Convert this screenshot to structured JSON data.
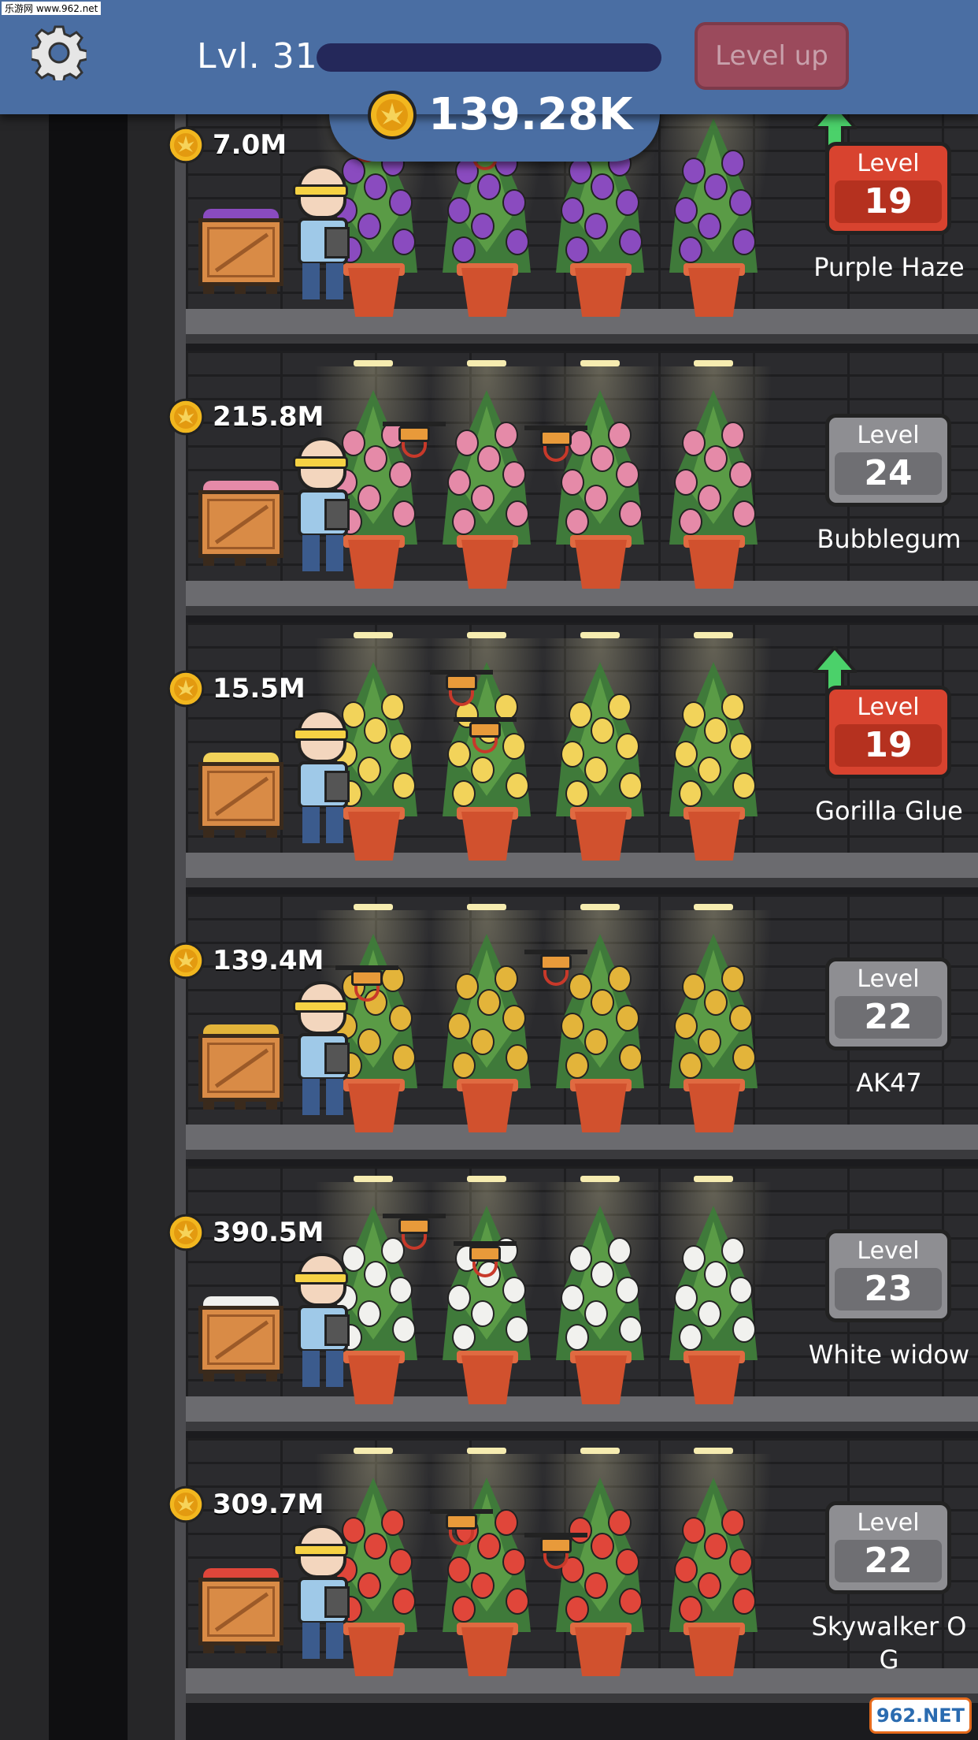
{
  "watermark": "乐游网 www.962.net",
  "logo": "962.NET",
  "header": {
    "level_label": "Lvl. 31",
    "xp_progress": 0.0,
    "level_up_label": "Level up",
    "total_money": "139.28K"
  },
  "colors": {
    "header_bg": "#4a6ea3",
    "level_up_disabled": "#9b4a5c",
    "badge_upgrade": "#d8432f",
    "badge_normal": "#8e8e92"
  },
  "floors": [
    {
      "earnings": "7.0M",
      "level_label": "Level",
      "level": "19",
      "strain": "Purple Haze",
      "upgradable": true,
      "bud_color": "#8a4bbf"
    },
    {
      "earnings": "215.8M",
      "level_label": "Level",
      "level": "24",
      "strain": "Bubblegum",
      "upgradable": false,
      "bud_color": "#e58aa8"
    },
    {
      "earnings": "15.5M",
      "level_label": "Level",
      "level": "19",
      "strain": "Gorilla Glue",
      "upgradable": true,
      "bud_color": "#f2d35a"
    },
    {
      "earnings": "139.4M",
      "level_label": "Level",
      "level": "22",
      "strain": "AK47",
      "upgradable": false,
      "bud_color": "#e3b43a"
    },
    {
      "earnings": "390.5M",
      "level_label": "Level",
      "level": "23",
      "strain": "White widow",
      "upgradable": false,
      "bud_color": "#f1f1ee"
    },
    {
      "earnings": "309.7M",
      "level_label": "Level",
      "level": "22",
      "strain": "Skywalker OG",
      "upgradable": false,
      "bud_color": "#e0463a"
    }
  ]
}
